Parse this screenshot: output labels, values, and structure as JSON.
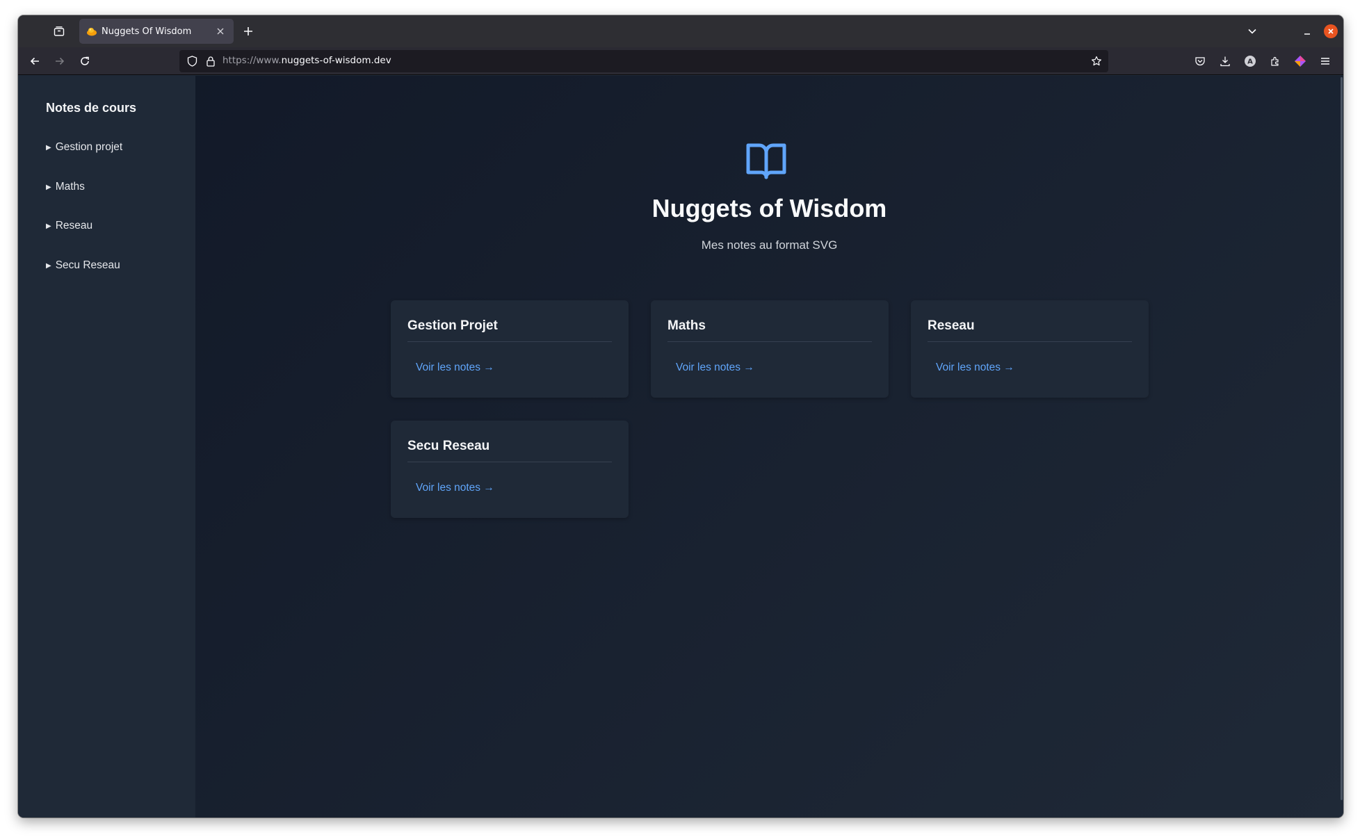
{
  "browser": {
    "tab_title": "Nuggets Of Wisdom",
    "url_prefix": "https://www.",
    "url_domain": "nuggets-of-wisdom.dev"
  },
  "sidebar": {
    "title": "Notes de cours",
    "items": [
      {
        "label": "Gestion projet"
      },
      {
        "label": "Maths"
      },
      {
        "label": "Reseau"
      },
      {
        "label": "Secu Reseau"
      }
    ]
  },
  "hero": {
    "icon": "open-book-icon",
    "title": "Nuggets of Wisdom",
    "subtitle": "Mes notes au format SVG"
  },
  "cards": [
    {
      "title": "Gestion Projet",
      "link": "Voir les notes →"
    },
    {
      "title": "Maths",
      "link": "Voir les notes →"
    },
    {
      "title": "Reseau",
      "link": "Voir les notes →"
    },
    {
      "title": "Secu Reseau",
      "link": "Voir les notes →"
    }
  ],
  "colors": {
    "accent": "#60a5fa",
    "page_bg": "#111827",
    "card_bg": "#1f2937",
    "window_close": "#e95420"
  }
}
